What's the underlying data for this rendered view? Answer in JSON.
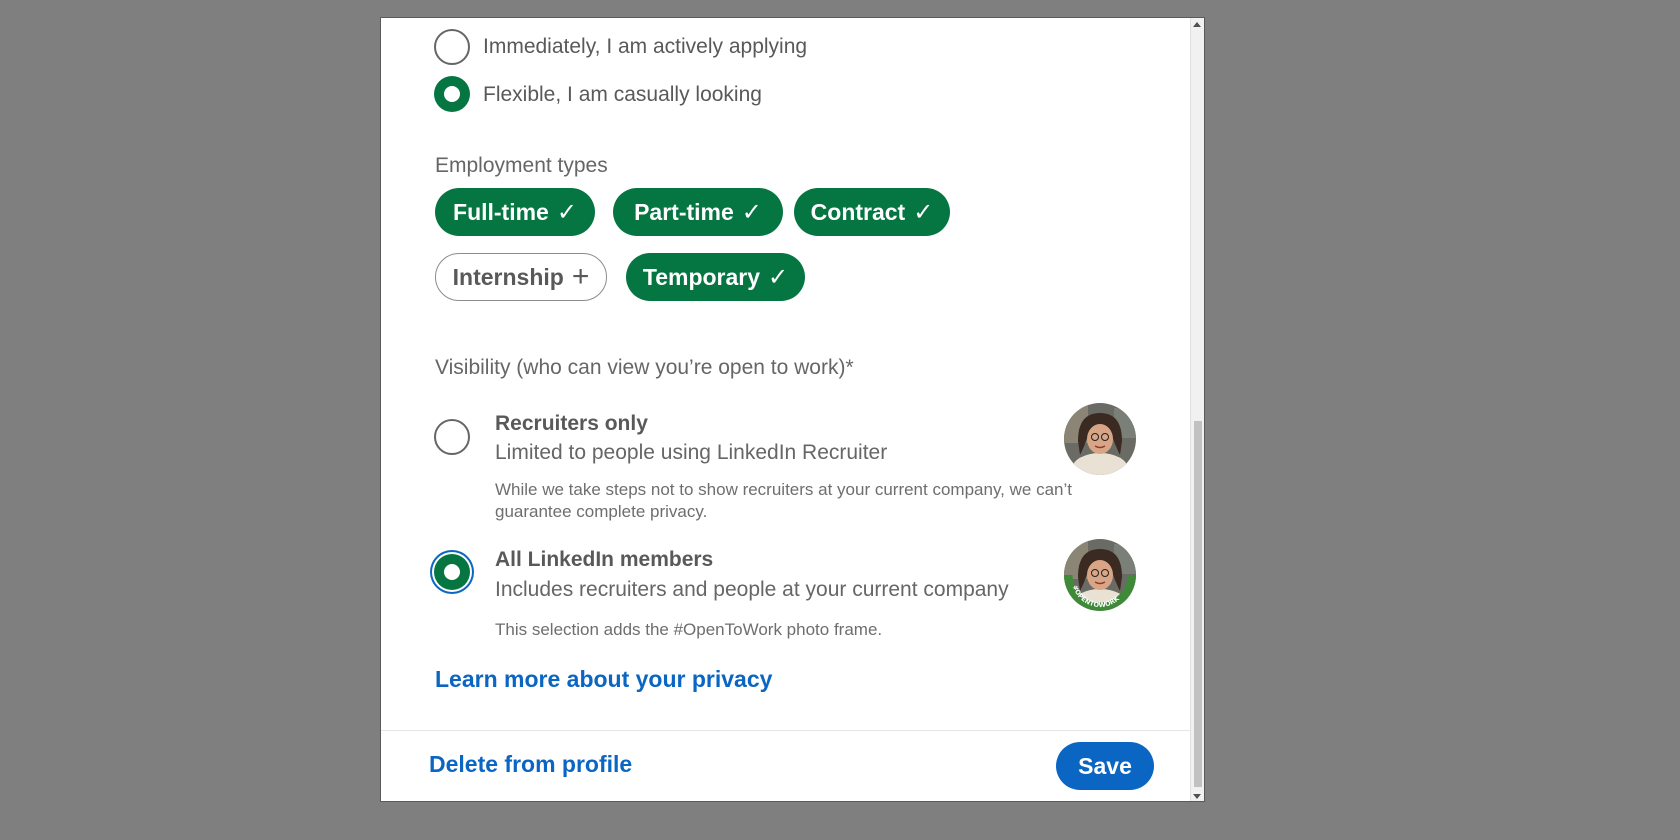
{
  "start_date": {
    "options": [
      {
        "label": "Immediately, I am actively applying",
        "checked": false
      },
      {
        "label": "Flexible, I am casually looking",
        "checked": true
      }
    ]
  },
  "employment": {
    "label": "Employment types",
    "types": [
      {
        "label": "Full-time",
        "selected": true,
        "mark": "✓"
      },
      {
        "label": "Part-time",
        "selected": true,
        "mark": "✓"
      },
      {
        "label": "Contract",
        "selected": true,
        "mark": "✓"
      },
      {
        "label": "Internship",
        "selected": false,
        "mark": "+"
      },
      {
        "label": "Temporary",
        "selected": true,
        "mark": "✓"
      }
    ]
  },
  "visibility": {
    "label": "Visibility (who can view you’re open to work)*",
    "options": [
      {
        "title": "Recruiters only",
        "subtitle": "Limited to people using LinkedIn Recruiter",
        "note": "While we take steps not to show recruiters at your current company, we can’t guarantee complete privacy.",
        "checked": false
      },
      {
        "title": "All LinkedIn members",
        "subtitle": "Includes recruiters and people at your current company",
        "note": "This selection adds the #OpenToWork photo frame.",
        "checked": true,
        "frame_text": "#OPENTOWORK"
      }
    ],
    "learn_more": "Learn more about your privacy"
  },
  "footer": {
    "delete_label": "Delete from profile",
    "save_label": "Save"
  },
  "colors": {
    "green": "#057642",
    "blue": "#0a66c2",
    "backdrop": "#7f7f7f"
  }
}
